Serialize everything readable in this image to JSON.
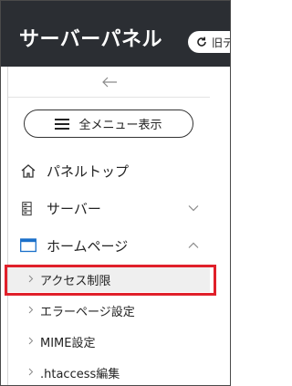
{
  "header": {
    "title": "サーバーパネル",
    "switch_label": "旧デ"
  },
  "sidebar": {
    "menu_button_label": "全メニュー表示",
    "items": [
      {
        "label": "パネルトップ"
      },
      {
        "label": "サーバー"
      },
      {
        "label": "ホームページ"
      }
    ],
    "sub_items": [
      {
        "label": "アクセス制限"
      },
      {
        "label": "エラーページ設定"
      },
      {
        "label": "MIME設定"
      },
      {
        "label": ".htaccess編集"
      }
    ]
  },
  "colors": {
    "header_bg": "#2b2e33",
    "highlight": "#e0202a",
    "selected_bg": "#efefef"
  }
}
